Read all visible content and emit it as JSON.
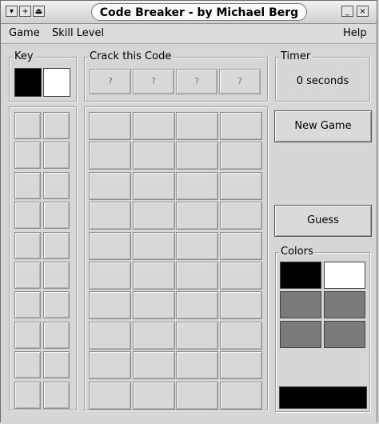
{
  "window": {
    "title": "Code Breaker - by Michael Berg",
    "buttons": {
      "menu": "▾",
      "add": "+",
      "shade": "⏏",
      "minimize": "_",
      "close": "×"
    }
  },
  "menubar": {
    "game": "Game",
    "skill_level": "Skill Level",
    "help": "Help"
  },
  "key": {
    "label": "Key",
    "swatches": [
      "#000000",
      "#ffffff"
    ]
  },
  "code": {
    "label": "Crack this Code",
    "slots": [
      "?",
      "?",
      "?",
      "?"
    ]
  },
  "timer": {
    "label": "Timer",
    "value": "0 seconds"
  },
  "buttons": {
    "new_game": "New Game",
    "guess": "Guess"
  },
  "colors": {
    "label": "Colors",
    "palette": [
      "#000000",
      "#ffffff",
      "#7a7a7a",
      "#7a7a7a",
      "#7a7a7a",
      "#7a7a7a"
    ],
    "selected": "#000000"
  },
  "board": {
    "rows": 10,
    "columns": 4
  }
}
